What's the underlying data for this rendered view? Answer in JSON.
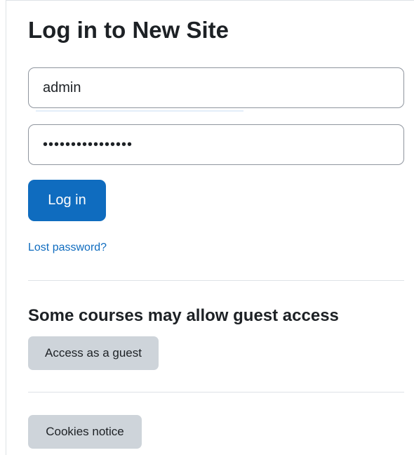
{
  "login": {
    "title": "Log in to New Site",
    "username_value": "admin",
    "password_value": "••••••••••••••••",
    "login_button": "Log in",
    "lost_password_link": "Lost password?"
  },
  "guest": {
    "heading": "Some courses may allow guest access",
    "button": "Access as a guest"
  },
  "footer": {
    "cookies_button": "Cookies notice"
  },
  "colors": {
    "primary": "#0f6cbf",
    "secondary_button": "#ced4da",
    "text": "#1d2125",
    "divider": "#dee2e6"
  }
}
